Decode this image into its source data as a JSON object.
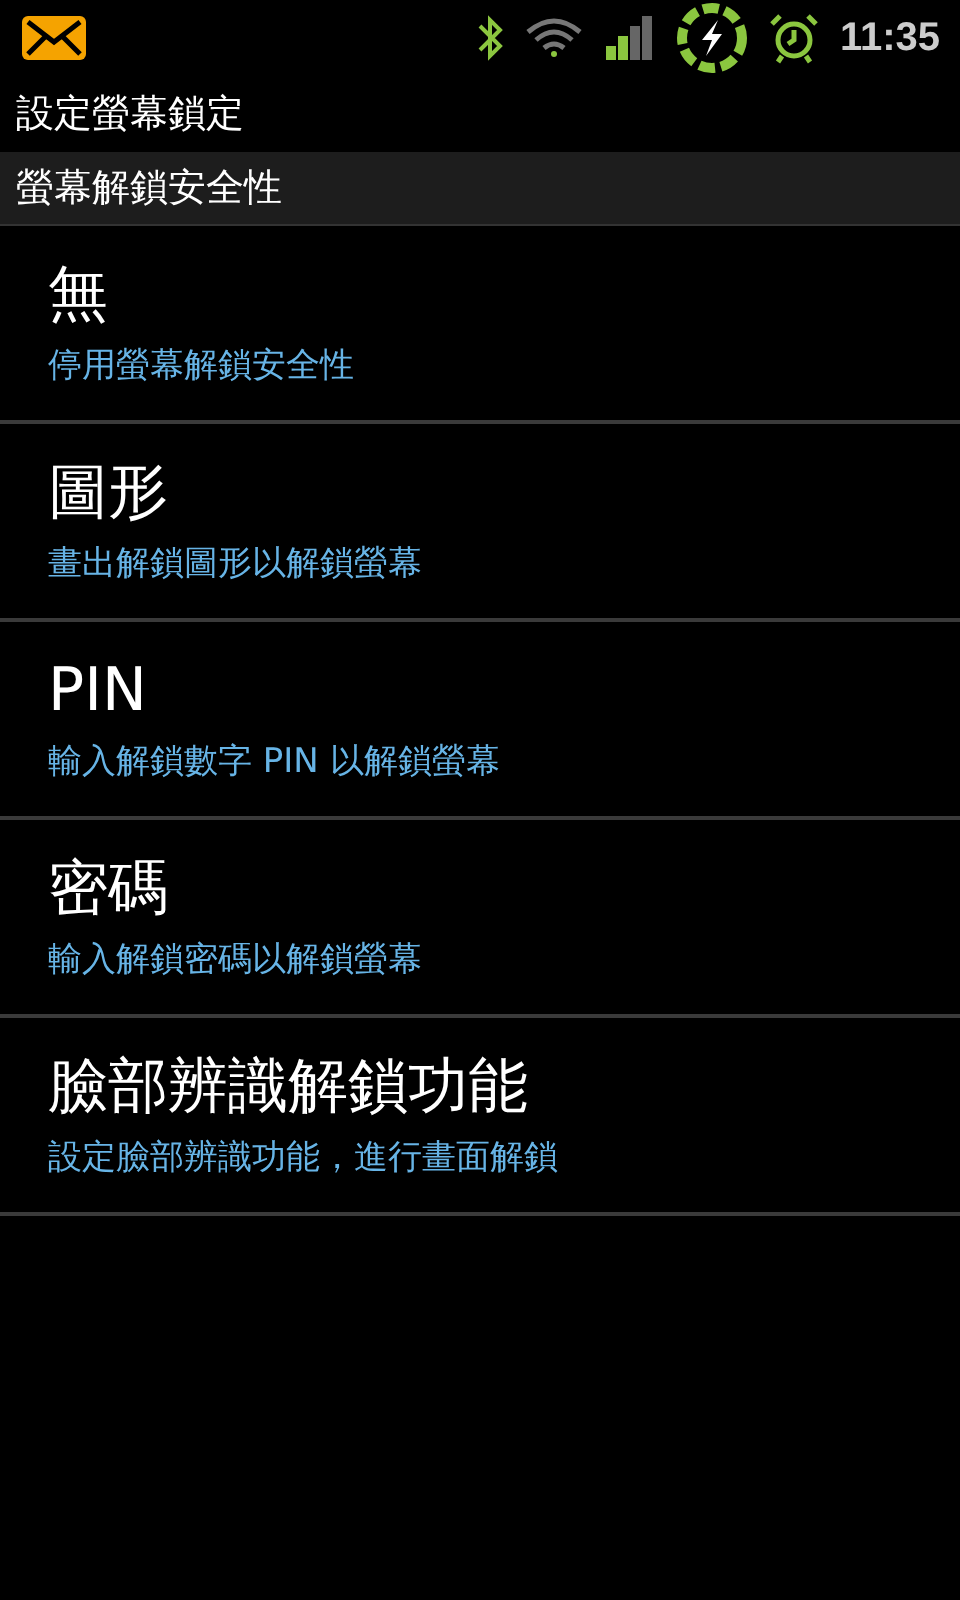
{
  "status_bar": {
    "time": "11:35"
  },
  "window": {
    "title": "設定螢幕鎖定"
  },
  "section": {
    "title": "螢幕解鎖安全性"
  },
  "options": [
    {
      "title": "無",
      "summary": "停用螢幕解鎖安全性"
    },
    {
      "title": "圖形",
      "summary": "畫出解鎖圖形以解鎖螢幕"
    },
    {
      "title": "PIN",
      "summary": "輸入解鎖數字 PIN 以解鎖螢幕"
    },
    {
      "title": "密碼",
      "summary": "輸入解鎖密碼以解鎖螢幕"
    },
    {
      "title": "臉部辨識解鎖功能",
      "summary": "設定臉部辨識功能，進行畫面解鎖"
    }
  ]
}
